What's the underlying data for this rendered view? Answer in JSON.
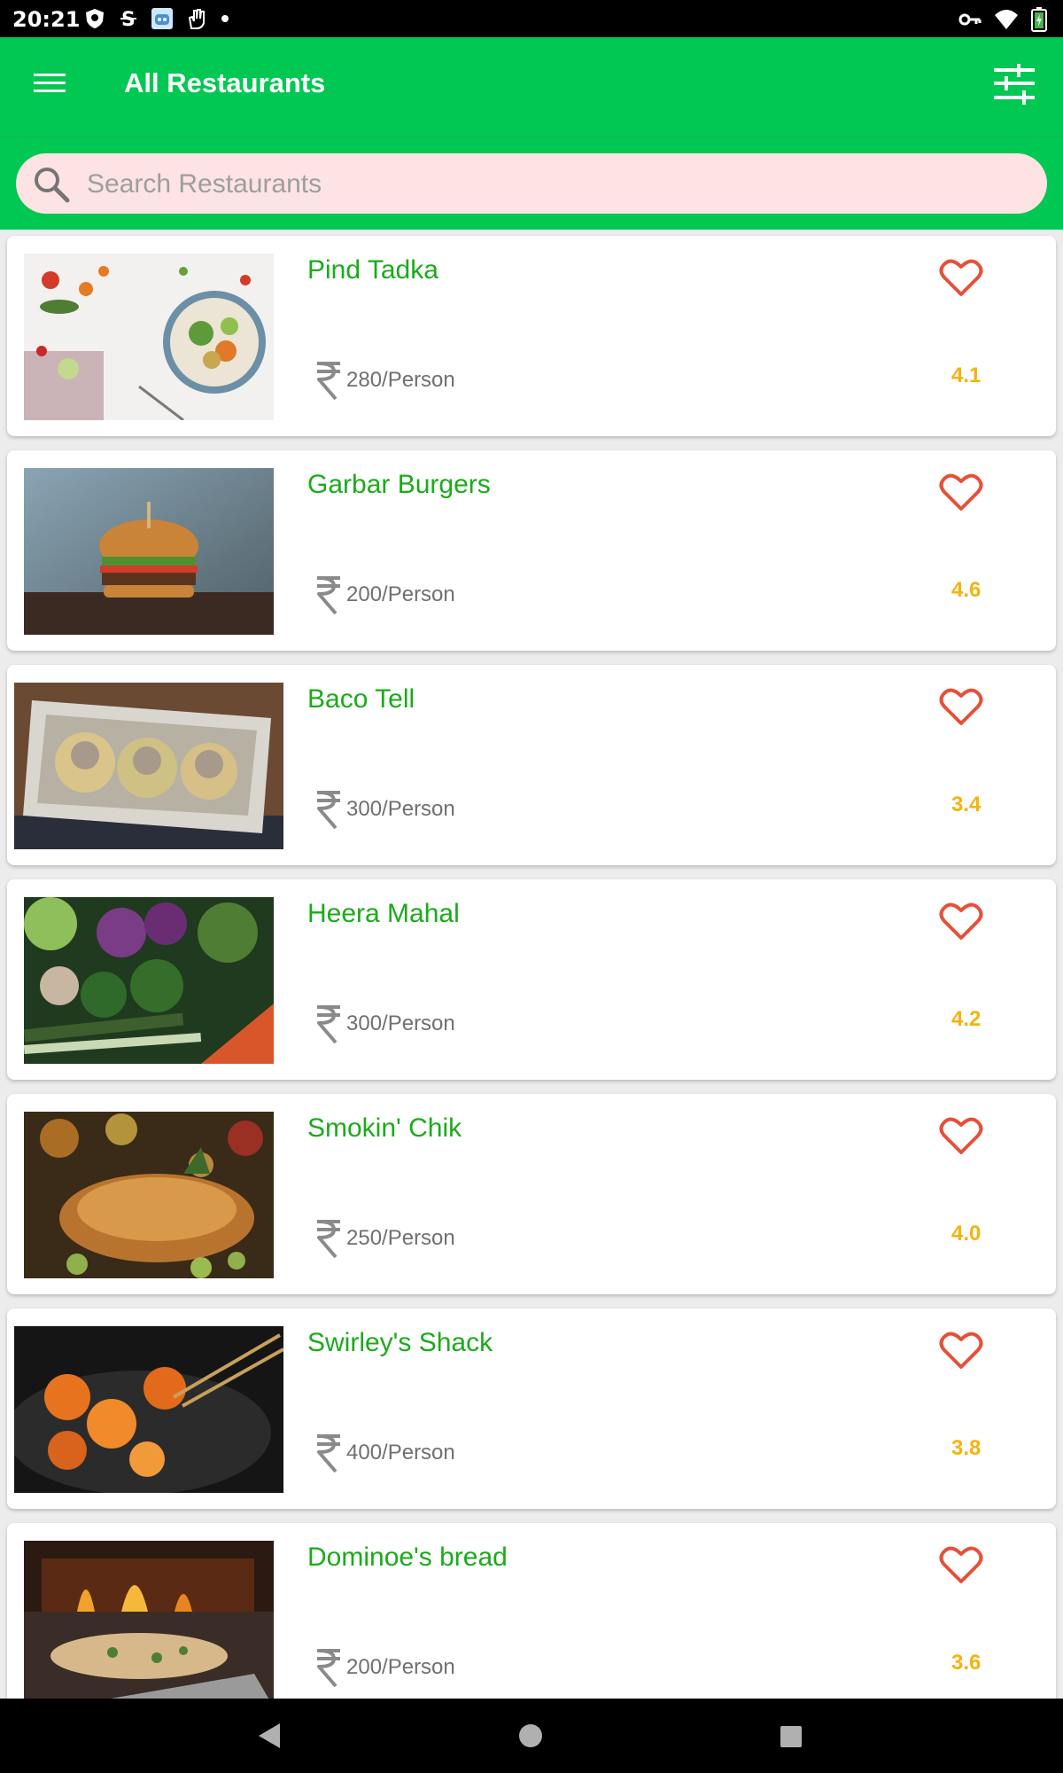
{
  "status_bar": {
    "time": "20:21",
    "left_icons": [
      "shield-app-icon",
      "s-app-icon",
      "robot-app-icon",
      "hand-app-icon",
      "dot-icon"
    ],
    "right_icons": [
      "key-icon",
      "wifi-icon",
      "battery-icon"
    ]
  },
  "app_bar": {
    "title": "All Restaurants",
    "background": "#00c853"
  },
  "search": {
    "placeholder": "Search Restaurants",
    "value": ""
  },
  "colors": {
    "name": "#1aab1a",
    "rating": "#f5b30c",
    "heart": "#e65039",
    "search_bg": "#fde3e3"
  },
  "restaurants": [
    {
      "name": "Pind Tadka",
      "price": "280/Person",
      "rating": "4.1",
      "favorite": false
    },
    {
      "name": "Garbar Burgers",
      "price": "200/Person",
      "rating": "4.6",
      "favorite": false
    },
    {
      "name": "Baco Tell",
      "price": "300/Person",
      "rating": "3.4",
      "favorite": false
    },
    {
      "name": "Heera Mahal",
      "price": "300/Person",
      "rating": "4.2",
      "favorite": false
    },
    {
      "name": "Smokin' Chik",
      "price": "250/Person",
      "rating": "4.0",
      "favorite": false
    },
    {
      "name": "Swirley's Shack",
      "price": "400/Person",
      "rating": "3.8",
      "favorite": false
    },
    {
      "name": "Dominoe's bread",
      "price": "200/Person",
      "rating": "3.6",
      "favorite": false
    }
  ],
  "nav_bar": {
    "icons": [
      "back-icon",
      "home-icon",
      "recents-icon"
    ]
  }
}
